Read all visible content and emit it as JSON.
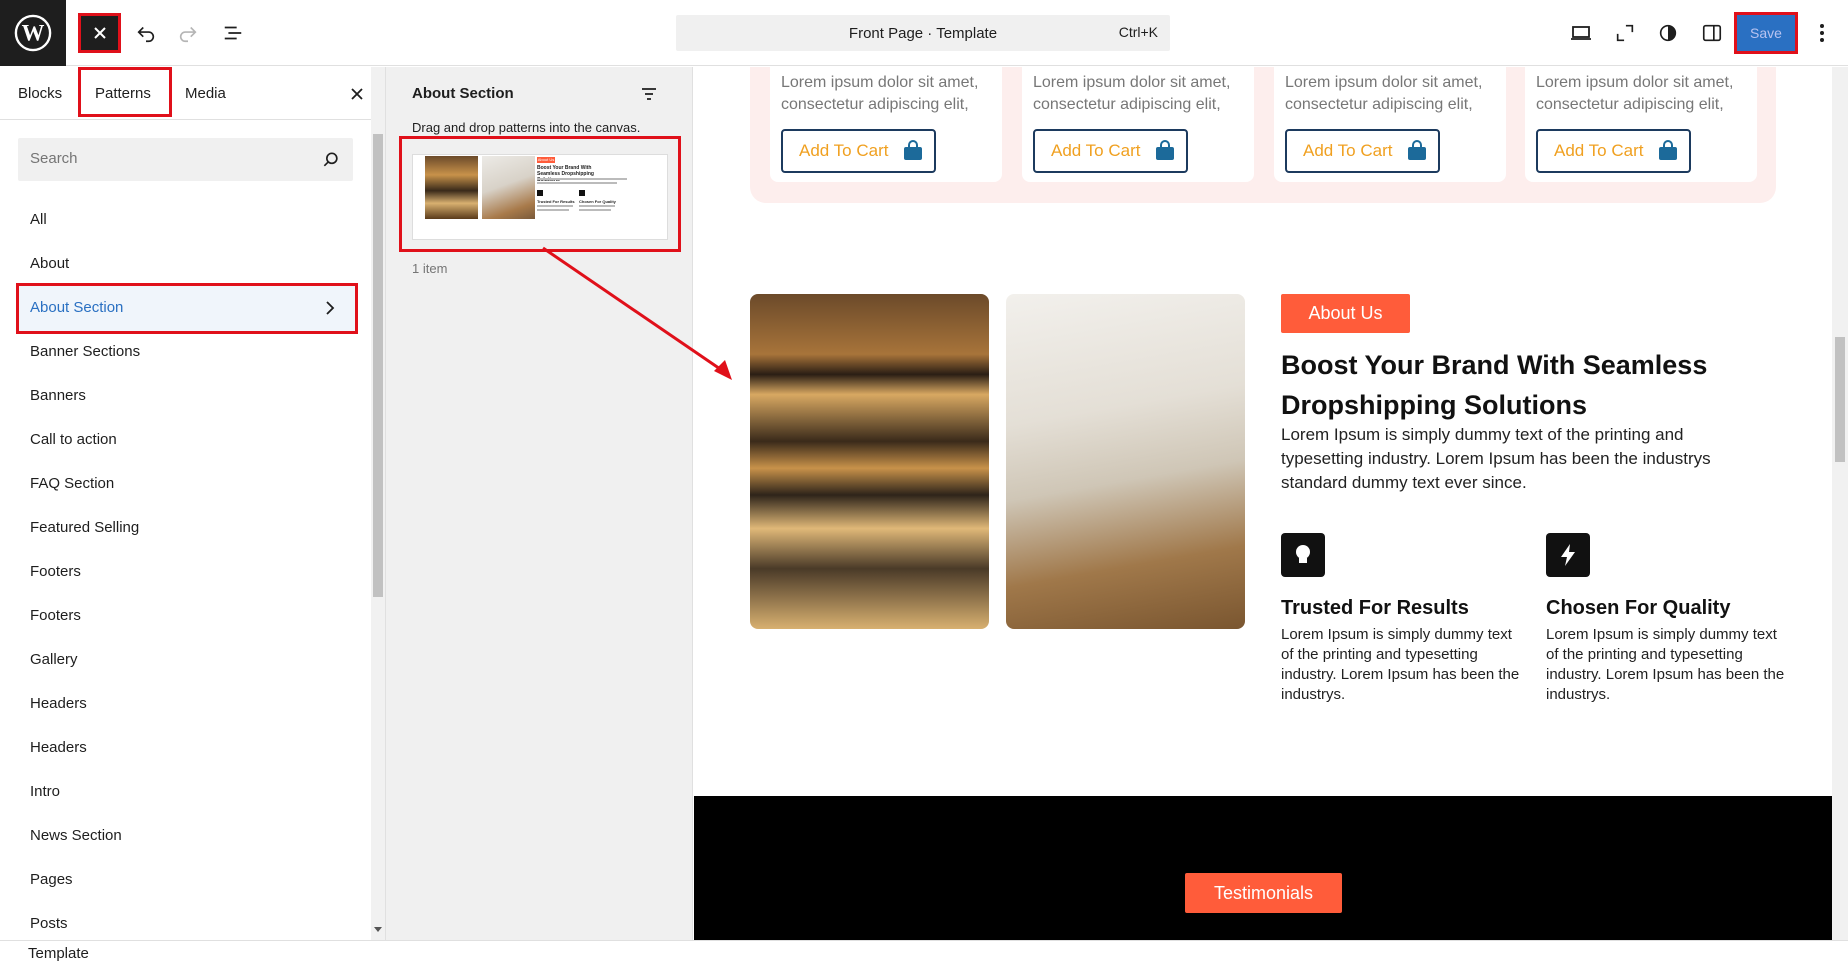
{
  "topbar": {
    "document_title": "Front Page · Template",
    "shortcut": "Ctrl+K",
    "save_label": "Save"
  },
  "inserter": {
    "tabs": [
      "Blocks",
      "Patterns",
      "Media"
    ],
    "search_placeholder": "Search",
    "categories": [
      "All",
      "About",
      "About Section",
      "Banner Sections",
      "Banners",
      "Call to action",
      "FAQ Section",
      "Featured Selling",
      "Footers",
      "Footers",
      "Gallery",
      "Headers",
      "Headers",
      "Intro",
      "News Section",
      "Pages",
      "Posts"
    ]
  },
  "pattern_panel": {
    "title": "About Section",
    "hint": "Drag and drop patterns into the canvas.",
    "count": "1 item",
    "thumb_badge": "About Us",
    "thumb_heading": "Boost Your Brand With Seamless Dropshipping Solutions",
    "thumb_feature_1": "Trusted For Results",
    "thumb_feature_2": "Chosen For Quality"
  },
  "canvas": {
    "card_text": "Lorem ipsum dolor sit amet, consectetur adipiscing elit,",
    "cart_label": "Add To Cart",
    "about_badge": "About Us",
    "about_heading": "Boost Your Brand With Seamless Dropshipping Solutions",
    "about_text": "Lorem Ipsum is simply dummy text of the printing and typesetting industry. Lorem Ipsum has been the industrys standard dummy text ever since.",
    "feature_1_title": "Trusted For Results",
    "feature_1_text": "Lorem Ipsum is simply dummy text of the printing and typesetting industry. Lorem Ipsum has been the industrys.",
    "feature_2_title": "Chosen For Quality",
    "feature_2_text": "Lorem Ipsum is simply dummy text of the printing and typesetting industry. Lorem Ipsum has been the industrys.",
    "testimonials_label": "Testimonials"
  },
  "status": {
    "breadcrumb": "Template"
  },
  "colors": {
    "accent_orange": "#ff5c3a",
    "cart_text": "#f0a020",
    "cart_border": "#1c3a5e",
    "highlight_red": "#e0101a",
    "save_blue": "#2a70c2"
  }
}
